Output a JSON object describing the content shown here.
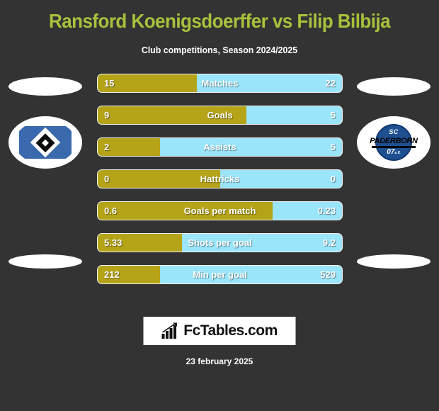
{
  "header": {
    "title": "Ransford Koenigsdoerffer vs Filip Bilbija",
    "subtitle": "Club competitions, Season 2024/2025"
  },
  "colors": {
    "background": "#333333",
    "title": "#a6c23c",
    "home_bar": "#b5a318",
    "away_bar": "#9ae5fa",
    "text": "#ffffff"
  },
  "teams": {
    "home": {
      "crest_name": "hamburger-sv-crest",
      "band_color": "#3a69ad"
    },
    "away": {
      "crest_name": "sc-paderborn-07-crest",
      "line1": "SC",
      "line2": "PADERBORN",
      "line3": "07",
      "line3_suffix": "e.V.",
      "circle_color": "#1d4f91"
    }
  },
  "chart_data": {
    "type": "bar",
    "title": "Ransford Koenigsdoerffer vs Filip Bilbija",
    "subtitle": "Club competitions, Season 2024/2025",
    "orientation": "horizontal-diverging",
    "series": [
      {
        "name": "Ransford Koenigsdoerffer",
        "color": "#b5a318",
        "align": "left"
      },
      {
        "name": "Filip Bilbija",
        "color": "#9ae5fa",
        "align": "right"
      }
    ],
    "categories": [
      "Matches",
      "Goals",
      "Assists",
      "Hattricks",
      "Goals per match",
      "Shots per goal",
      "Min per goal"
    ],
    "rows": [
      {
        "label": "Matches",
        "home": "15",
        "away": "22",
        "home_pct": 40.5
      },
      {
        "label": "Goals",
        "home": "9",
        "away": "5",
        "home_pct": 61.0
      },
      {
        "label": "Assists",
        "home": "2",
        "away": "5",
        "home_pct": 25.6
      },
      {
        "label": "Hattricks",
        "home": "0",
        "away": "0",
        "home_pct": 50.0
      },
      {
        "label": "Goals per match",
        "home": "0.6",
        "away": "0.23",
        "home_pct": 71.5
      },
      {
        "label": "Shots per goal",
        "home": "5.33",
        "away": "9.2",
        "home_pct": 34.6
      },
      {
        "label": "Min per goal",
        "home": "212",
        "away": "529",
        "home_pct": 25.4
      }
    ]
  },
  "footer": {
    "logo_icon": "bar-chart-trend-icon",
    "logo_text": "FcTables.com",
    "date": "23 february 2025"
  }
}
